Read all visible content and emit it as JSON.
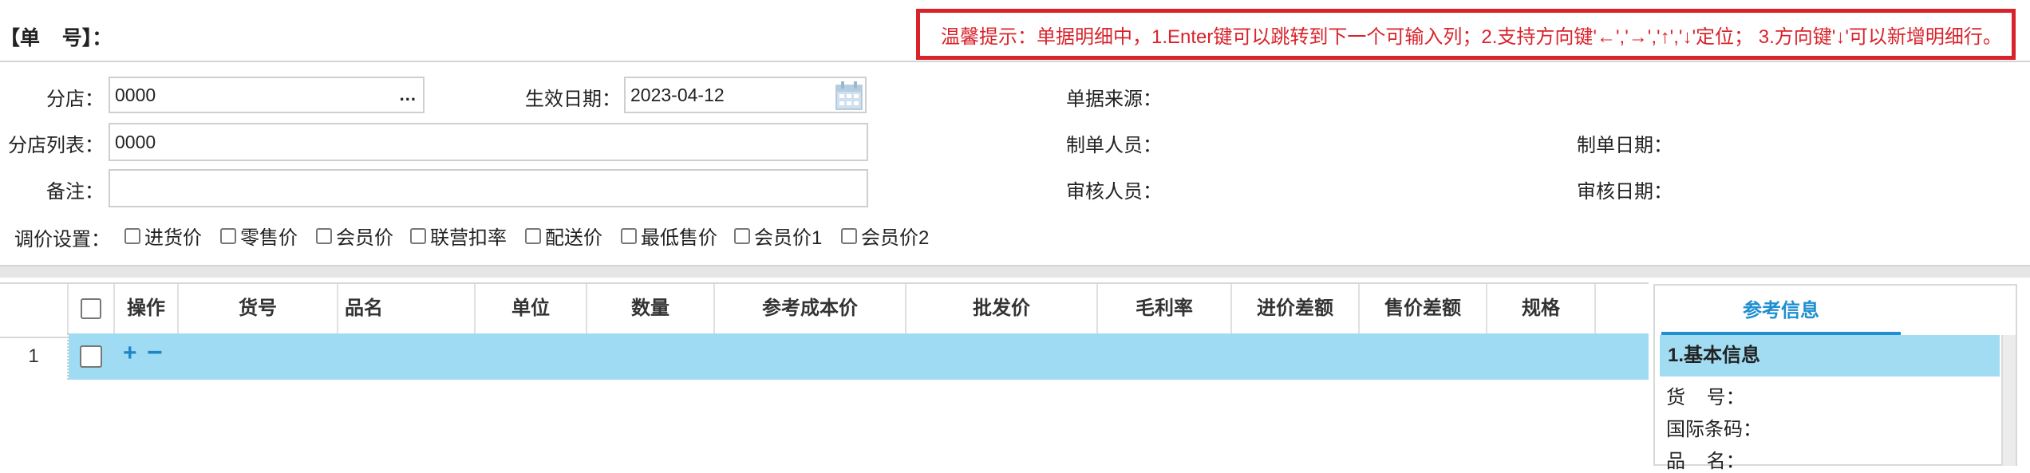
{
  "header": {
    "doc_no_label": "【单    号】：",
    "tip": "温馨提示：单据明细中，1.Enter键可以跳转到下一个可输入列；2.支持方向键'←','→','↑','↓'定位；  3.方向键'↓'可以新增明细行。"
  },
  "form": {
    "branch_label": "分店：",
    "branch_value": "0000",
    "branch_picker": "...",
    "effective_date_label": "生效日期：",
    "effective_date_value": "2023-04-12",
    "branch_list_label": "分店列表：",
    "branch_list_value": "0000",
    "remark_label": "备注：",
    "remark_value": "",
    "source_label": "单据来源：",
    "creator_label": "制单人员：",
    "create_date_label": "制单日期：",
    "reviewer_label": "审核人员：",
    "review_date_label": "审核日期：",
    "price_settings_label": "调价设置：",
    "price_options": [
      "进货价",
      "零售价",
      "会员价",
      "联营扣率",
      "配送价",
      "最低售价",
      "会员价1",
      "会员价2"
    ]
  },
  "grid": {
    "columns": [
      "操作",
      "货号",
      "品名",
      "单位",
      "数量",
      "参考成本价",
      "批发价",
      "毛利率",
      "进价差额",
      "售价差额",
      "规格"
    ],
    "rows": [
      {
        "num": "1",
        "add": "+",
        "remove": "−"
      }
    ]
  },
  "side_panel": {
    "tab": "参考信息",
    "section": "1.基本信息",
    "fields": [
      "货    号：",
      "国际条码：",
      "品    名："
    ]
  },
  "colors": {
    "tip_red": "#d9232b",
    "row_highlight": "#9fdcf3",
    "accent_blue": "#1f8fd2"
  }
}
